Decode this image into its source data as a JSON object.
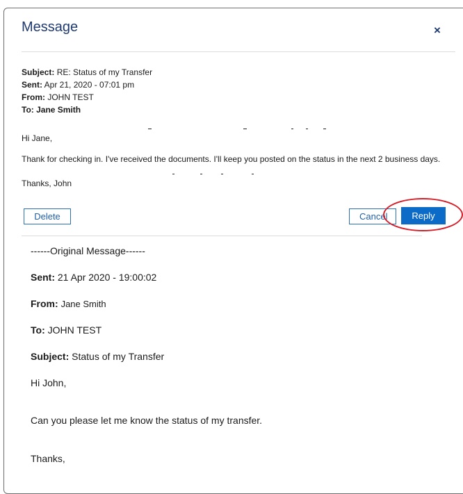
{
  "dialog": {
    "title": "Message",
    "close_glyph": "×"
  },
  "message": {
    "subject_label": "Subject:",
    "subject_value": "RE: Status of my Transfer",
    "sent_label": "Sent:",
    "sent_value": "Apr 21, 2020 - 07:01 pm",
    "from_label": "From:",
    "from_value": "JOHN TEST",
    "to_label": "To:",
    "to_value": "Jane Smith",
    "greeting": "Hi Jane,",
    "body": "Thank for checking in. I've received the documents. I'll keep you posted on the status in the next 2  business days.",
    "signoff": "Thanks, John"
  },
  "actions": {
    "delete_label": "Delete",
    "cancel_label": "Cancel",
    "reply_label": "Reply",
    "highlight_color": "#d51d28",
    "primary_color": "#0d6bc8"
  },
  "original": {
    "header": "------Original Message------",
    "sent_label": "Sent:",
    "sent_value": "21 Apr 2020 - 19:00:02",
    "from_label": "From:",
    "from_value": "Jane Smith",
    "to_label": "To:",
    "to_value": "JOHN TEST",
    "subject_label": "Subject:",
    "subject_value": "Status of my Transfer",
    "greeting": "Hi John,",
    "body": "Can you please let me know the status of my transfer.",
    "signoff": "Thanks,"
  }
}
